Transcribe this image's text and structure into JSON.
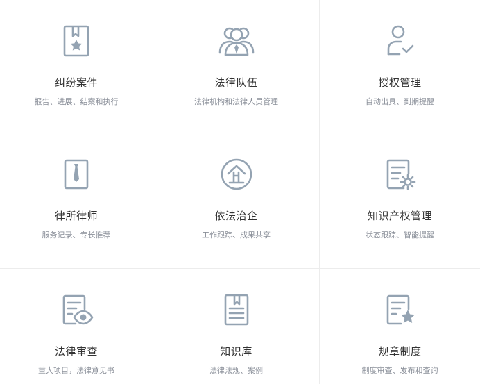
{
  "colors": {
    "icon": "#94a3b2",
    "title": "#333333",
    "desc": "#8a8f99",
    "divider": "#ececec"
  },
  "cards": [
    {
      "title": "纠纷案件",
      "desc": "报告、进展、结案和执行",
      "icon": "case-bookmark-star-icon"
    },
    {
      "title": "法律队伍",
      "desc": "法律机构和法律人员管理",
      "icon": "team-people-icon"
    },
    {
      "title": "授权管理",
      "desc": "自动出具、到期提醒",
      "icon": "user-check-icon"
    },
    {
      "title": "律所律师",
      "desc": "服务记录、专长推荐",
      "icon": "lawyer-tie-icon"
    },
    {
      "title": "依法治企",
      "desc": "工作跟踪、成果共享",
      "icon": "enterprise-circle-icon"
    },
    {
      "title": "知识产权管理",
      "desc": "状态跟踪、智能提醒",
      "icon": "document-gear-icon"
    },
    {
      "title": "法律审查",
      "desc": "重大项目，法律意见书",
      "icon": "document-eye-icon"
    },
    {
      "title": "知识库",
      "desc": "法律法规、案例",
      "icon": "book-bookmark-icon"
    },
    {
      "title": "规章制度",
      "desc": "制度审查、发布和查询",
      "icon": "document-star-icon"
    }
  ]
}
